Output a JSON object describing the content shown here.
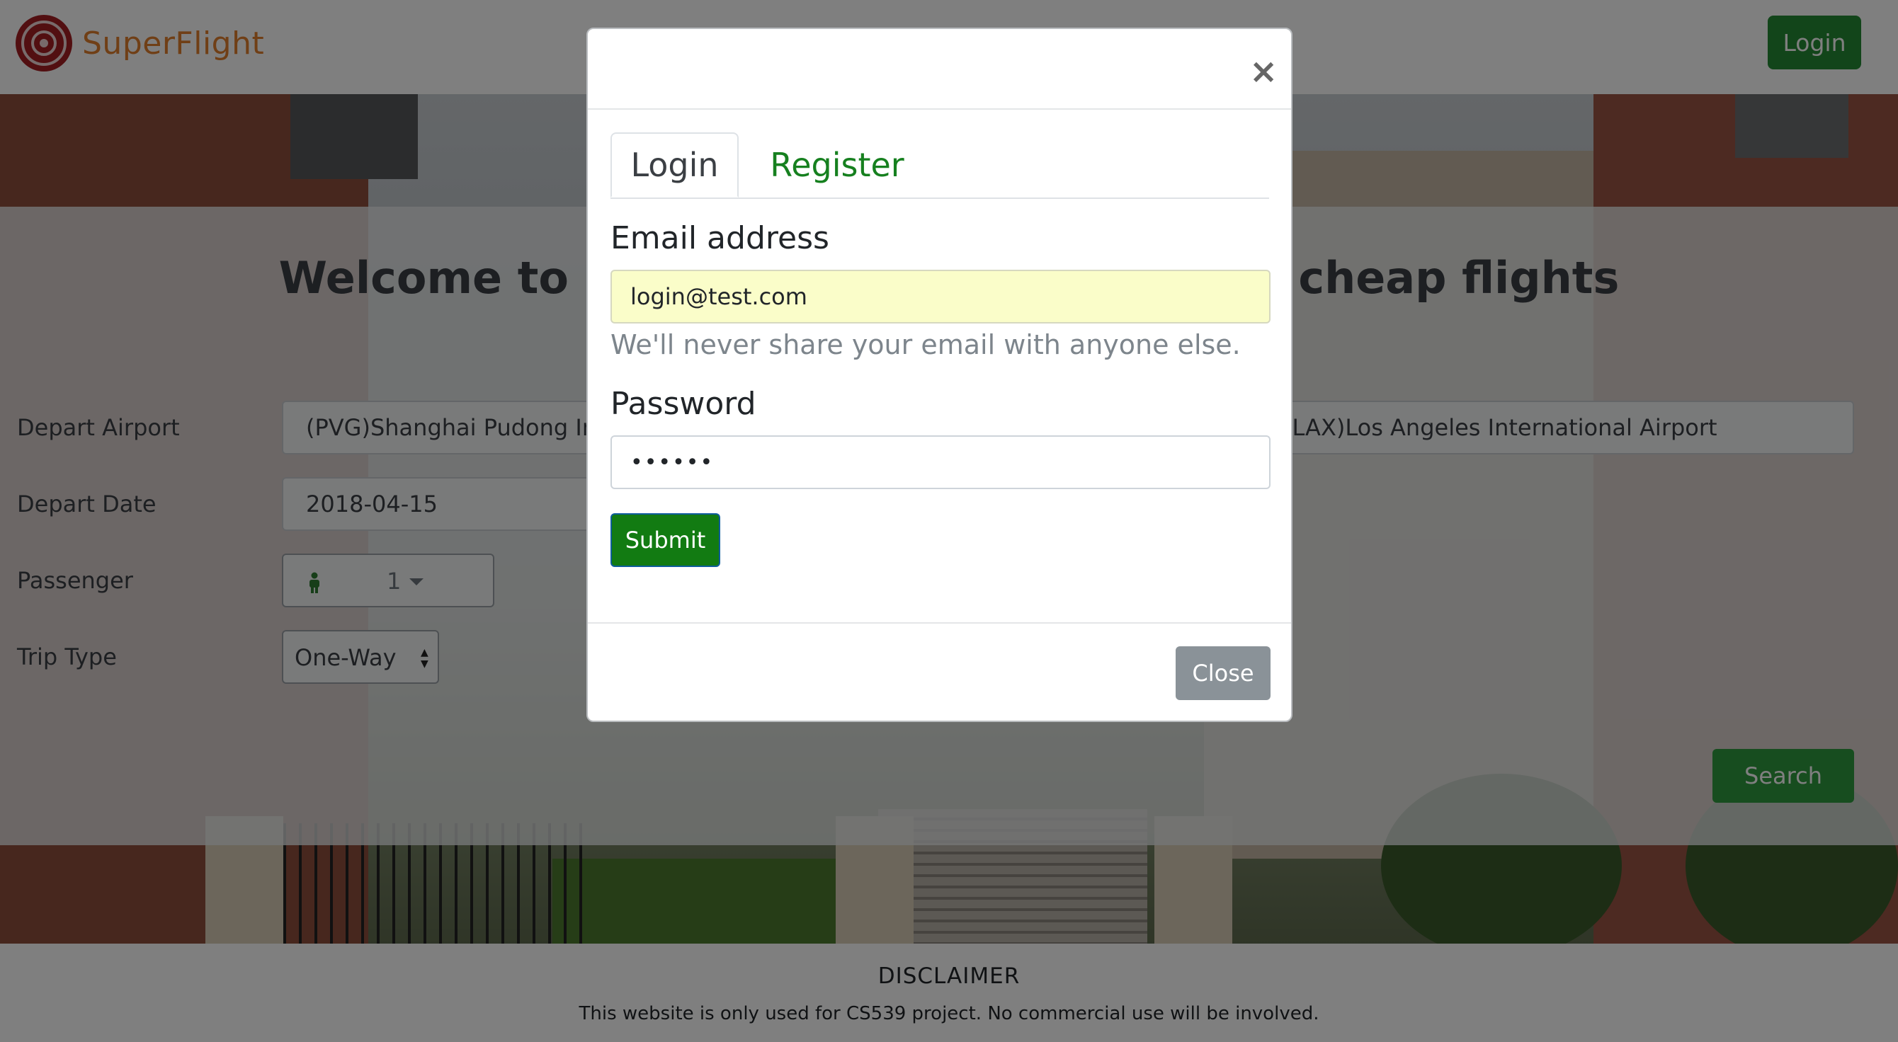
{
  "header": {
    "brand_name": "SuperFlight",
    "login_label": "Login"
  },
  "hero": {
    "welcome_text": "Welcome to SuperFlight, your search for cheap flights"
  },
  "search_form": {
    "depart_airport_label": "Depart Airport",
    "depart_airport_value": "(PVG)Shanghai Pudong International Airport",
    "arrive_airport_value": "(LAX)Los Angeles International Airport",
    "depart_date_label": "Depart Date",
    "depart_date_value": "2018-04-15",
    "passenger_label": "Passenger",
    "passenger_count": "1",
    "trip_type_label": "Trip Type",
    "trip_type_value": "One-Way",
    "search_label": "Search"
  },
  "footer": {
    "disclaimer_title": "DISCLAIMER",
    "disclaimer_text": "This website is only used for CS539 project. No commercial use will be involved."
  },
  "modal": {
    "close_x": "×",
    "tabs": [
      {
        "label": "Login",
        "active": true
      },
      {
        "label": "Register",
        "active": false
      }
    ],
    "email_label": "Email address",
    "email_value": "login@test.com",
    "email_help": "We'll never share your email with anyone else.",
    "password_label": "Password",
    "password_value": "••••••",
    "submit_label": "Submit",
    "close_label": "Close"
  },
  "colors": {
    "brand_orange": "#e07e2c",
    "primary_green": "#258b34",
    "tab_green": "#16801f",
    "email_autofill": "#fafdc9",
    "close_gray": "#8a9298"
  },
  "icons": [
    "brand-logo-icon",
    "close-x-icon",
    "person-icon",
    "caret-down-icon",
    "select-arrows-icon"
  ]
}
